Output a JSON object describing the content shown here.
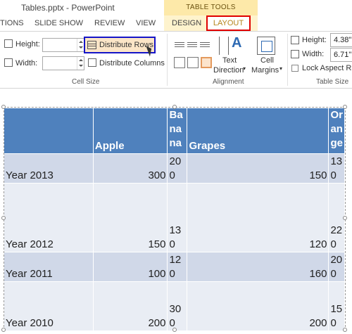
{
  "window": {
    "title": "Tables.pptx - PowerPoint"
  },
  "contextual": {
    "label": "TABLE TOOLS"
  },
  "tabs": [
    {
      "label": "TIONS"
    },
    {
      "label": "SLIDE SHOW"
    },
    {
      "label": "REVIEW"
    },
    {
      "label": "VIEW"
    },
    {
      "label": "DESIGN"
    },
    {
      "label": "LAYOUT"
    }
  ],
  "cell_size": {
    "height_label": "Height:",
    "width_label": "Width:",
    "distribute_rows": "Distribute Rows",
    "distribute_columns": "Distribute Columns",
    "group_label": "Cell Size"
  },
  "alignment": {
    "text_direction": "Text",
    "text_direction2": "Direction",
    "cell_margins": "Cell",
    "cell_margins2": "Margins",
    "group_label": "Alignment"
  },
  "table_size": {
    "height_label": "Height:",
    "height_value": "4.38\"",
    "width_label": "Width:",
    "width_value": "6.71\"",
    "lock_label": "Lock Aspect Ra",
    "group_label": "Table Size"
  },
  "table": {
    "headers": [
      "",
      "Apple",
      "Ba na na",
      "Grapes",
      "Or an ge"
    ],
    "rows": [
      [
        "Year 2013",
        "300",
        "20 0",
        "150",
        "13 0"
      ],
      [
        "Year 2012",
        "150",
        "13 0",
        "120",
        "22 0"
      ],
      [
        "Year 2011",
        "100",
        "12 0",
        "160",
        "20 0"
      ],
      [
        "Year 2010",
        "200",
        "30 0",
        "200",
        "15 0"
      ]
    ]
  },
  "colors": {
    "header": "#4f81bd",
    "row_odd": "#d0d8e8",
    "row_even": "#e9edf4",
    "highlight_red": "#e00000",
    "highlight_blue": "#1414c8"
  }
}
